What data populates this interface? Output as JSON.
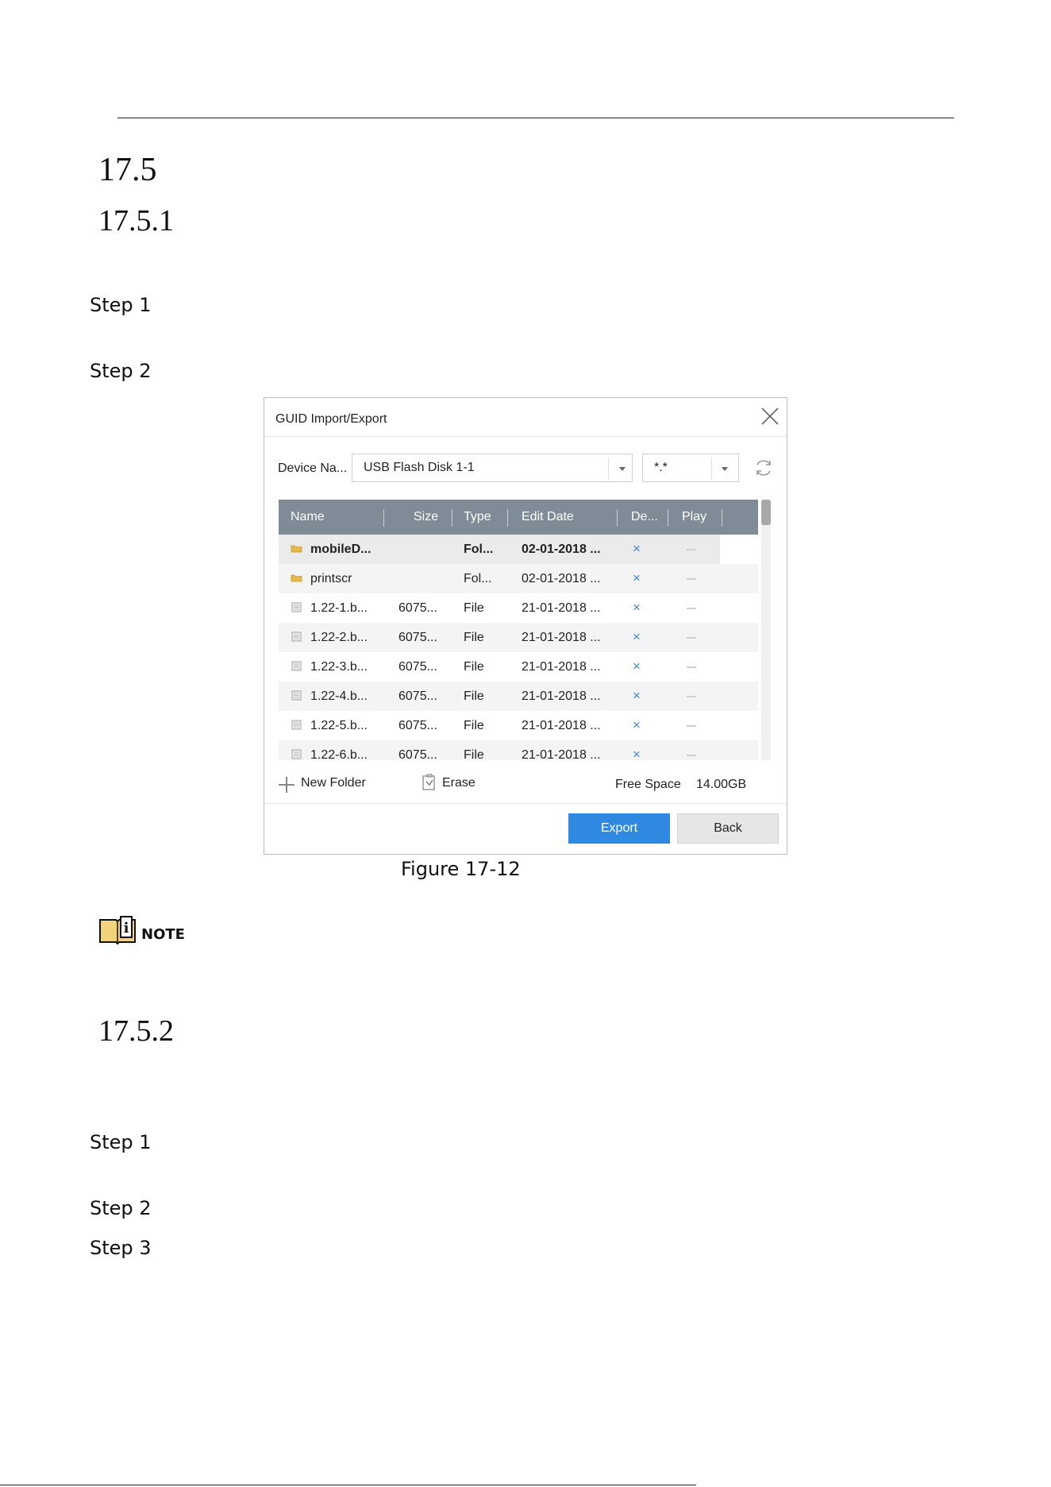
{
  "headings": {
    "section": "17.5",
    "subsection1": "17.5.1",
    "subsection2": "17.5.2"
  },
  "steps_a": [
    "Step 1",
    "Step 2"
  ],
  "steps_b": [
    "Step 1",
    "Step 2",
    "Step 3"
  ],
  "dialog": {
    "title": "GUID Import/Export",
    "device_label": "Device Na...",
    "device_value": "USB Flash Disk 1-1",
    "filter_value": "*.*",
    "columns": [
      "Name",
      "Size",
      "Type",
      "Edit Date",
      "De...",
      "Play"
    ],
    "rows": [
      {
        "icon": "folder",
        "name": "mobileD...",
        "size": "",
        "type": "Fol...",
        "date": "02-01-2018 ...",
        "delete": "×"
      },
      {
        "icon": "folder",
        "name": "printscr",
        "size": "",
        "type": "Fol...",
        "date": "02-01-2018 ...",
        "delete": "×"
      },
      {
        "icon": "file",
        "name": "1.22-1.b...",
        "size": "6075...",
        "type": "File",
        "date": "21-01-2018 ...",
        "delete": "×"
      },
      {
        "icon": "file",
        "name": "1.22-2.b...",
        "size": "6075...",
        "type": "File",
        "date": "21-01-2018 ...",
        "delete": "×"
      },
      {
        "icon": "file",
        "name": "1.22-3.b...",
        "size": "6075...",
        "type": "File",
        "date": "21-01-2018 ...",
        "delete": "×"
      },
      {
        "icon": "file",
        "name": "1.22-4.b...",
        "size": "6075...",
        "type": "File",
        "date": "21-01-2018 ...",
        "delete": "×"
      },
      {
        "icon": "file",
        "name": "1.22-5.b...",
        "size": "6075...",
        "type": "File",
        "date": "21-01-2018 ...",
        "delete": "×"
      },
      {
        "icon": "file",
        "name": "1.22-6.b...",
        "size": "6075...",
        "type": "File",
        "date": "21-01-2018 ...",
        "delete": "×"
      }
    ],
    "new_folder": "New Folder",
    "erase": "Erase",
    "free_space_label": "Free Space",
    "free_space_value": "14.00GB",
    "export": "Export",
    "back": "Back"
  },
  "caption": "Figure 17-12",
  "note_label": "NOTE",
  "note_icon_letter": "i",
  "colors": {
    "header_bg": "#7f8b96",
    "export_bg": "#2f89e0",
    "delete_mark": "#3d86d8",
    "folder": "#e8b94a"
  }
}
